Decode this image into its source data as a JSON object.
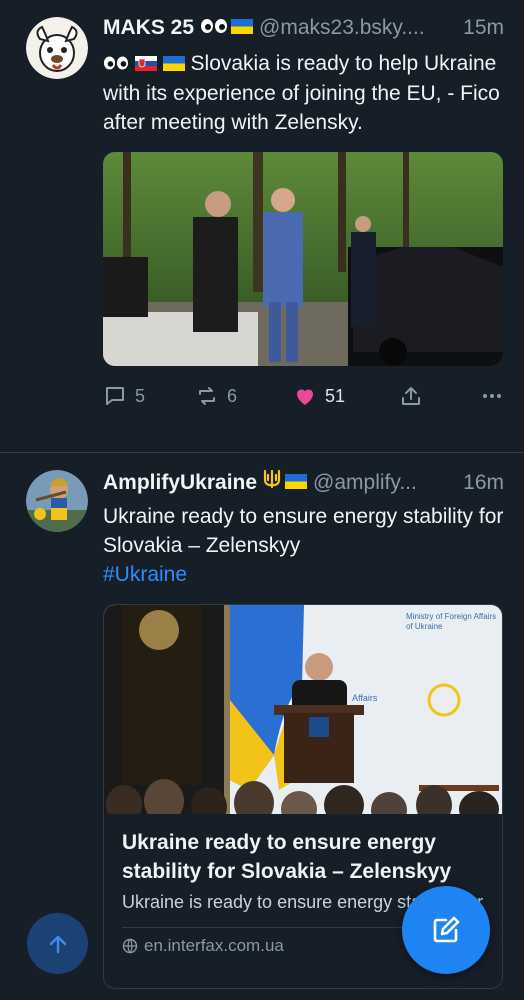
{
  "posts": [
    {
      "author": "MAKS 25",
      "handle": "@maks23.bsky....",
      "time": "15m",
      "text": "Slovakia is ready to help Ukraine with its experience of joining the EU, - Fico after meeting with Zelensky.",
      "replies": "5",
      "reposts": "6",
      "likes": "51",
      "liked": true
    },
    {
      "author": "AmplifyUkraine",
      "handle": "@amplify...",
      "time": "16m",
      "text": "Ukraine ready to ensure energy stability for Slovakia – Zelenskyy",
      "hashtag": "#Ukraine",
      "card": {
        "title": "Ukraine ready to ensure energy stability for Slovakia – Zelenskyy",
        "description": "Ukraine is ready to ensure energy stability for Slovakia, but not w",
        "domain": "en.interfax.com.ua",
        "image_sign_text": "Ministry of Foreign Affairs of Ukraine"
      }
    }
  ],
  "colors": {
    "background": "#161e27",
    "accent": "#1e84f3",
    "like": "#ec4899",
    "muted": "#8a98a8",
    "link": "#2f8cff"
  },
  "icons": {
    "reply": "speech-bubble-icon",
    "repost": "repost-icon",
    "like": "heart-icon",
    "share": "share-icon",
    "more": "ellipsis-icon",
    "scroll_top": "arrow-up-icon",
    "compose": "compose-icon",
    "globe": "globe-icon"
  }
}
